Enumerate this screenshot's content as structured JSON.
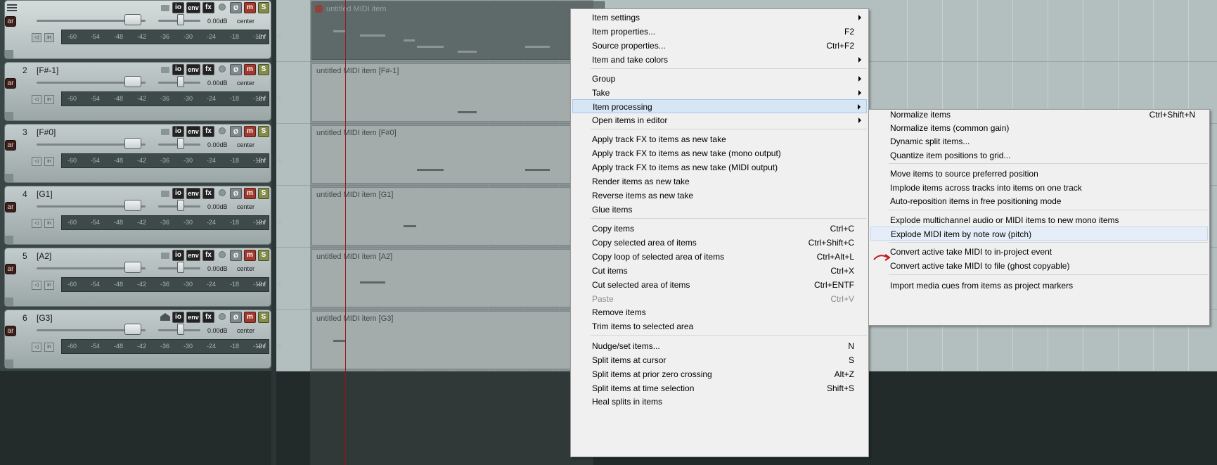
{
  "tracks": [
    {
      "num": "",
      "name": "",
      "vol": "0.00dB",
      "pan": "center",
      "inf": "-inf",
      "selected": true
    },
    {
      "num": "2",
      "name": "[F#-1]",
      "vol": "0.00dB",
      "pan": "center",
      "inf": "-inf"
    },
    {
      "num": "3",
      "name": "[F#0]",
      "vol": "0.00dB",
      "pan": "center",
      "inf": "-inf"
    },
    {
      "num": "4",
      "name": "[G1]",
      "vol": "0.00dB",
      "pan": "center",
      "inf": "-inf"
    },
    {
      "num": "5",
      "name": "[A2]",
      "vol": "0.00dB",
      "pan": "center",
      "inf": "-inf"
    },
    {
      "num": "6",
      "name": "[G3]",
      "vol": "0.00dB",
      "pan": "center",
      "inf": "-inf"
    }
  ],
  "track_buttons": {
    "arm": "ar",
    "io": "io",
    "env": "env",
    "fx": "fx",
    "mute": "m",
    "solo": "S",
    "phase": "Ø",
    "mon1": "◁",
    "mon2": "in"
  },
  "meter_ticks": [
    "-60",
    "-54",
    "-48",
    "-42",
    "-36",
    "-30",
    "-24",
    "-18",
    "-12",
    "-6"
  ],
  "items": [
    {
      "label": "untitled MIDI item",
      "selected": true
    },
    {
      "label": "untitled MIDI item [F#-1]"
    },
    {
      "label": "untitled MIDI item [F#0]"
    },
    {
      "label": "untitled MIDI item [G1]"
    },
    {
      "label": "untitled MIDI item [A2]"
    },
    {
      "label": "untitled MIDI item [G3]"
    }
  ],
  "menu": {
    "items": [
      {
        "label": "Item settings",
        "submenu": true
      },
      {
        "label": "Item properties...",
        "shortcut": "F2"
      },
      {
        "label": "Source properties...",
        "shortcut": "Ctrl+F2"
      },
      {
        "label": "Item and take colors",
        "submenu": true
      },
      {
        "label": "Group",
        "submenu": true
      },
      {
        "label": "Take",
        "submenu": true
      },
      {
        "label": "Item processing",
        "submenu": true,
        "highlighted": true
      },
      {
        "label": "Open items in editor",
        "submenu": true
      },
      {
        "label": "Apply track FX to items as new take"
      },
      {
        "label": "Apply track FX to items as new take (mono output)"
      },
      {
        "label": "Apply track FX to items as new take (MIDI output)"
      },
      {
        "label": "Render items as new take"
      },
      {
        "label": "Reverse items as new take"
      },
      {
        "label": "Glue items"
      },
      {
        "label": "Copy items",
        "shortcut": "Ctrl+C"
      },
      {
        "label": "Copy selected area of items",
        "shortcut": "Ctrl+Shift+C"
      },
      {
        "label": "Copy loop of selected area of items",
        "shortcut": "Ctrl+Alt+L"
      },
      {
        "label": "Cut items",
        "shortcut": "Ctrl+X"
      },
      {
        "label": "Cut selected area of items",
        "shortcut": "Ctrl+ENTF"
      },
      {
        "label": "Paste",
        "shortcut": "Ctrl+V",
        "disabled": true
      },
      {
        "label": "Remove items"
      },
      {
        "label": "Trim items to selected area"
      },
      {
        "label": "Nudge/set items...",
        "shortcut": "N"
      },
      {
        "label": "Split items at cursor",
        "shortcut": "S"
      },
      {
        "label": "Split items at prior zero crossing",
        "shortcut": "Alt+Z"
      },
      {
        "label": "Split items at time selection",
        "shortcut": "Shift+S"
      },
      {
        "label": "Heal splits in items"
      }
    ]
  },
  "submenu": {
    "items": [
      {
        "label": "Normalize items",
        "shortcut": "Ctrl+Shift+N"
      },
      {
        "label": "Normalize items (common gain)"
      },
      {
        "label": "Dynamic split items..."
      },
      {
        "label": "Quantize item positions to grid..."
      },
      {
        "label": "Move items to source preferred position"
      },
      {
        "label": "Implode items across tracks into items on one track"
      },
      {
        "label": "Auto-reposition items in free positioning mode"
      },
      {
        "label": "Explode multichannel audio or MIDI items to new mono items"
      },
      {
        "label": "Explode MIDI item by note row (pitch)",
        "highlighted": true
      },
      {
        "label": "Convert active take MIDI to in-project event"
      },
      {
        "label": "Convert active take MIDI to file (ghost copyable)"
      },
      {
        "label": "Import media cues from items as project markers"
      }
    ]
  },
  "colors": {
    "cursor": "#a01212",
    "mute": "#a0392e",
    "solo": "#838d4b",
    "menu_highlight": "#d7e6f5"
  }
}
